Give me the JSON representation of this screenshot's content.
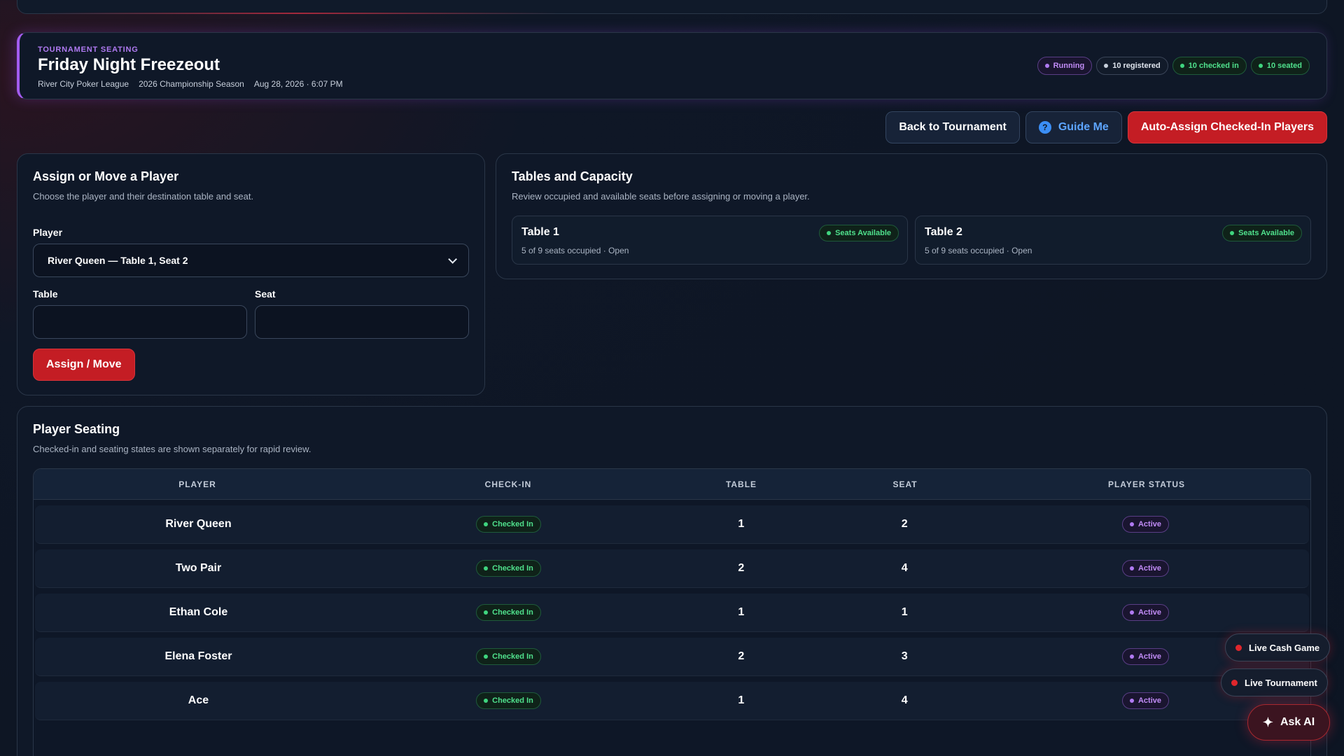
{
  "header": {
    "eyebrow": "TOURNAMENT SEATING",
    "title": "Friday Night Freezeout",
    "league": "River City Poker League",
    "season": "2026 Championship Season",
    "datetime": "Aug 28, 2026 · 6:07 PM",
    "badges": {
      "status": "Running",
      "registered": "10 registered",
      "checked_in": "10 checked in",
      "seated": "10 seated"
    }
  },
  "actions": {
    "back": "Back to Tournament",
    "guide": "Guide Me",
    "auto_assign": "Auto-Assign Checked-In Players"
  },
  "assign_panel": {
    "title": "Assign or Move a Player",
    "subtitle": "Choose the player and their destination table and seat.",
    "player_label": "Player",
    "player_selected": "River Queen — Table 1, Seat 2",
    "table_label": "Table",
    "table_value": "",
    "seat_label": "Seat",
    "seat_value": "",
    "submit": "Assign / Move"
  },
  "tables_panel": {
    "title": "Tables and Capacity",
    "subtitle": "Review occupied and available seats before assigning or moving a player.",
    "tables": [
      {
        "name": "Table 1",
        "summary": "5 of 9 seats occupied · Open",
        "badge": "Seats Available"
      },
      {
        "name": "Table 2",
        "summary": "5 of 9 seats occupied · Open",
        "badge": "Seats Available"
      }
    ]
  },
  "seating_panel": {
    "title": "Player Seating",
    "subtitle": "Checked-in and seating states are shown separately for rapid review.",
    "columns": [
      "PLAYER",
      "CHECK-IN",
      "TABLE",
      "SEAT",
      "PLAYER STATUS"
    ],
    "rows": [
      {
        "player": "River Queen",
        "checkin": "Checked In",
        "table": "1",
        "seat": "2",
        "status": "Active"
      },
      {
        "player": "Two Pair",
        "checkin": "Checked In",
        "table": "2",
        "seat": "4",
        "status": "Active"
      },
      {
        "player": "Ethan Cole",
        "checkin": "Checked In",
        "table": "1",
        "seat": "1",
        "status": "Active"
      },
      {
        "player": "Elena Foster",
        "checkin": "Checked In",
        "table": "2",
        "seat": "3",
        "status": "Active"
      },
      {
        "player": "Ace",
        "checkin": "Checked In",
        "table": "1",
        "seat": "4",
        "status": "Active"
      }
    ]
  },
  "floating": {
    "live_cash": "Live Cash Game",
    "live_tournament": "Live Tournament",
    "ask_ai": "Ask AI"
  },
  "colors": {
    "accent_red": "#c41d24",
    "accent_purple": "#b07af2",
    "status_green": "#3fd57f",
    "link_blue": "#5da5ff"
  }
}
